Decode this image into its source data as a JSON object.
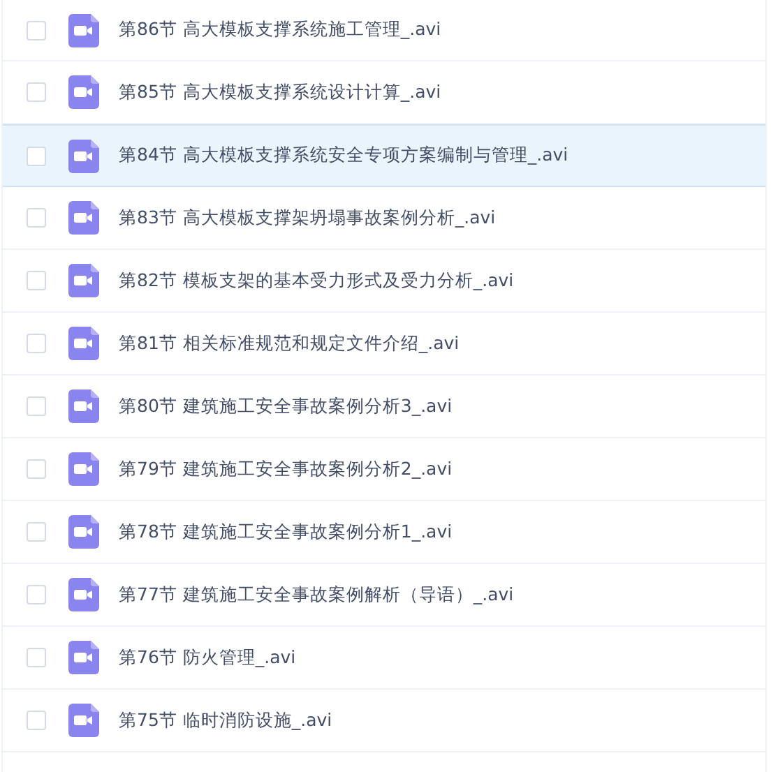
{
  "files": [
    {
      "name": "第86节 高大模板支撑系统施工管理_.avi",
      "checked": false,
      "highlighted": false
    },
    {
      "name": "第85节 高大模板支撑系统设计计算_.avi",
      "checked": false,
      "highlighted": false
    },
    {
      "name": "第84节 高大模板支撑系统安全专项方案编制与管理_.avi",
      "checked": false,
      "highlighted": true
    },
    {
      "name": "第83节 高大模板支撑架坍塌事故案例分析_.avi",
      "checked": false,
      "highlighted": false
    },
    {
      "name": "第82节 模板支架的基本受力形式及受力分析_.avi",
      "checked": false,
      "highlighted": false
    },
    {
      "name": "第81节 相关标准规范和规定文件介绍_.avi",
      "checked": false,
      "highlighted": false
    },
    {
      "name": "第80节 建筑施工安全事故案例分析3_.avi",
      "checked": false,
      "highlighted": false
    },
    {
      "name": "第79节 建筑施工安全事故案例分析2_.avi",
      "checked": false,
      "highlighted": false
    },
    {
      "name": "第78节 建筑施工安全事故案例分析1_.avi",
      "checked": false,
      "highlighted": false
    },
    {
      "name": "第77节 建筑施工安全事故案例解析（导语）_.avi",
      "checked": false,
      "highlighted": false
    },
    {
      "name": "第76节 防火管理_.avi",
      "checked": false,
      "highlighted": false
    },
    {
      "name": "第75节 临时消防设施_.avi",
      "checked": false,
      "highlighted": false
    }
  ]
}
